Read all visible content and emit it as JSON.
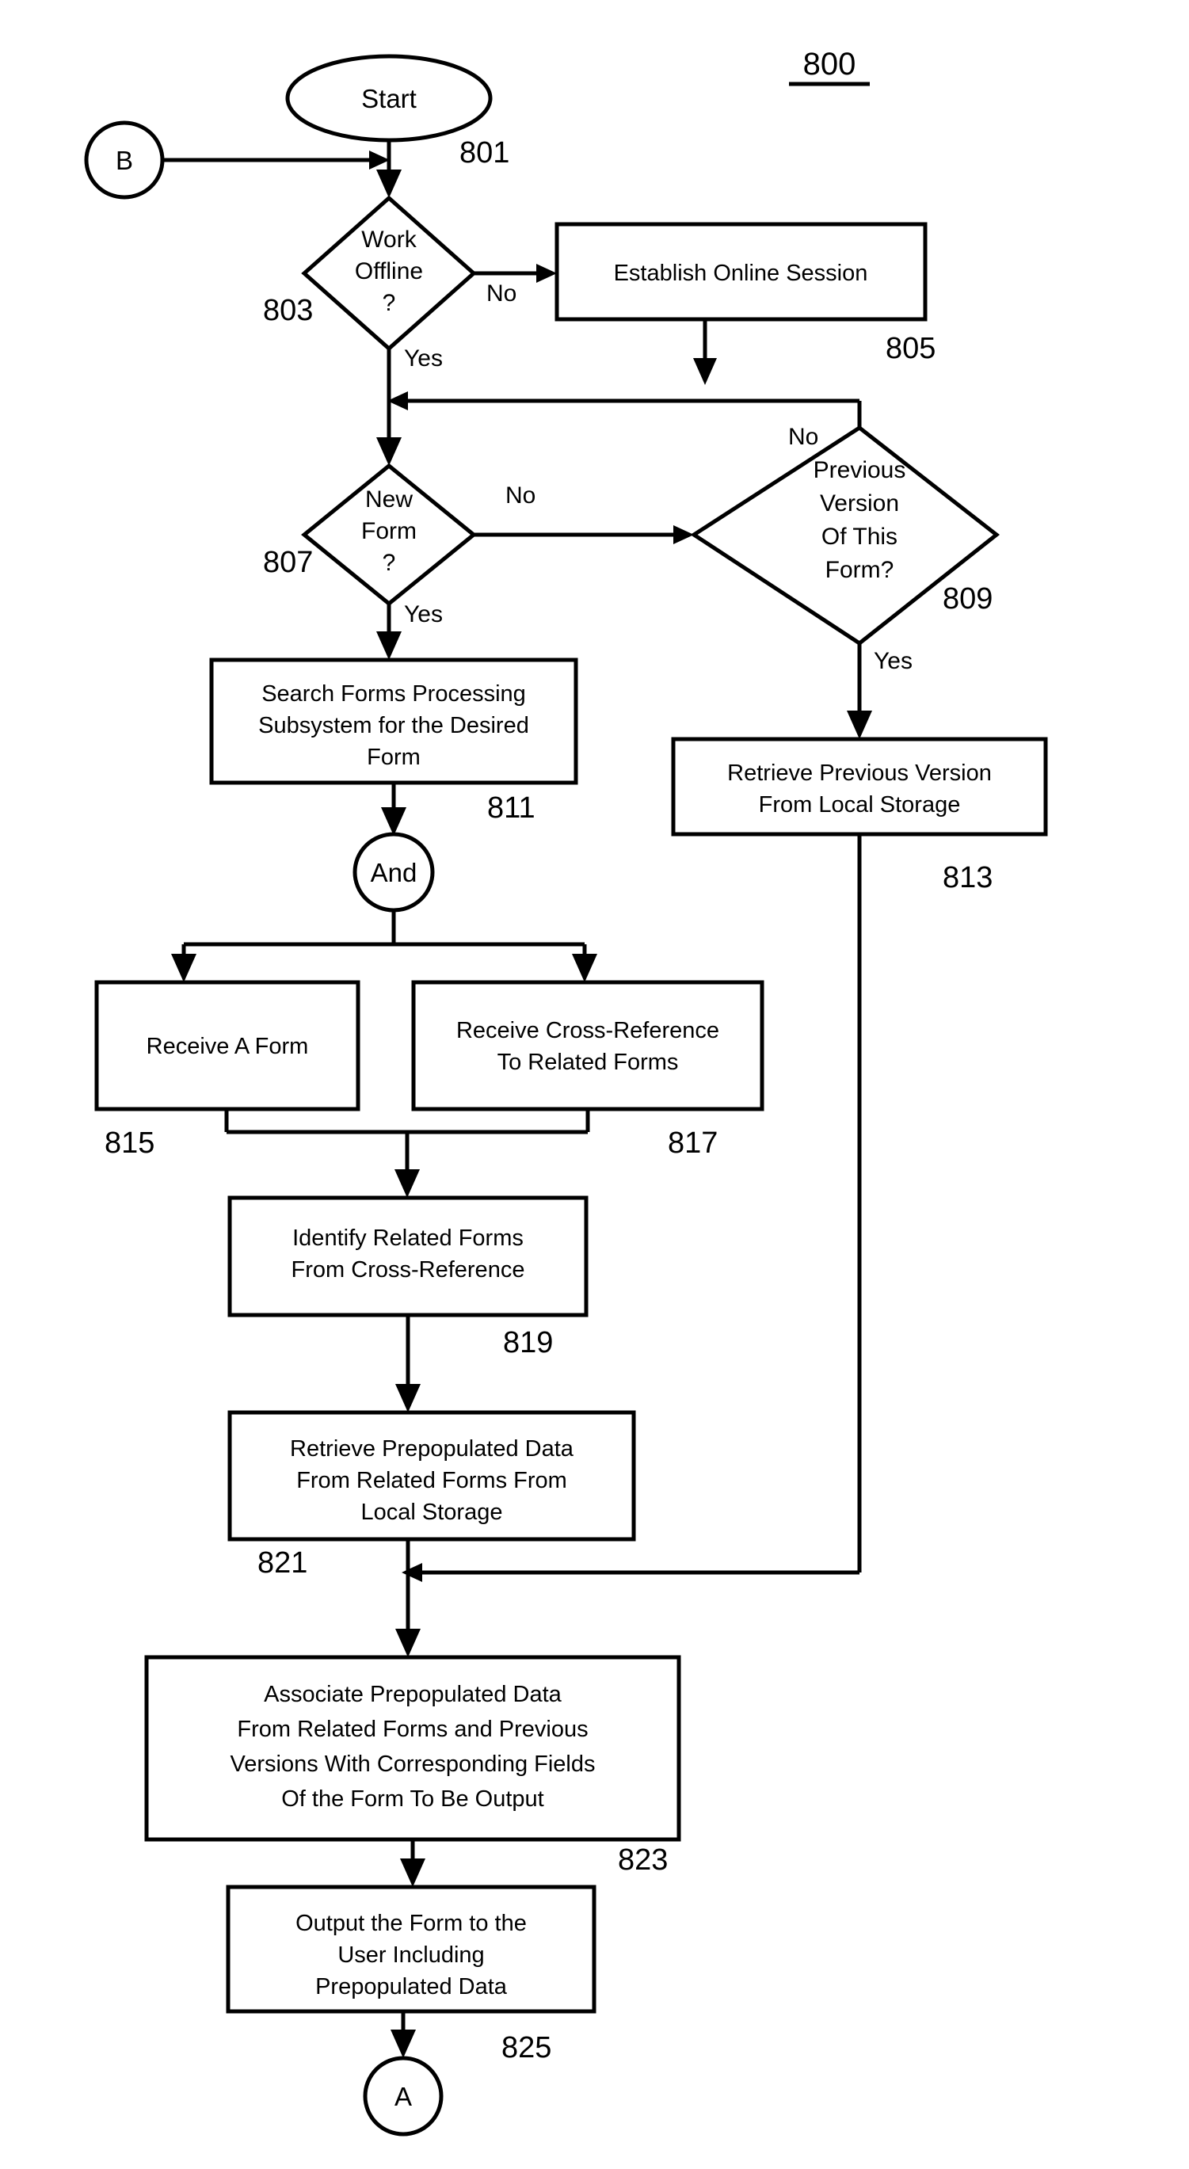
{
  "figure": {
    "number": "800",
    "underlined": true
  },
  "nodes": {
    "connector_b": {
      "label": "B",
      "shape": "circle"
    },
    "start": {
      "label": "Start",
      "shape": "ellipse",
      "ref": "801"
    },
    "work_offline": {
      "line1": "Work",
      "line2": "Offline",
      "line3": "?",
      "shape": "diamond",
      "ref": "803"
    },
    "establish_online": {
      "line1": "Establish Online Session",
      "shape": "rect",
      "ref": "805"
    },
    "new_form": {
      "line1": "New",
      "line2": "Form",
      "line3": "?",
      "shape": "diamond",
      "ref": "807"
    },
    "previous_version": {
      "line1": "Previous",
      "line2": "Version",
      "line3": "Of This",
      "line4": "Form?",
      "shape": "diamond",
      "ref": "809"
    },
    "search_forms": {
      "line1": "Search Forms Processing",
      "line2": "Subsystem for the Desired",
      "line3": "Form",
      "shape": "rect",
      "ref": "811"
    },
    "and_junction": {
      "label": "And",
      "shape": "circle"
    },
    "retrieve_previous": {
      "line1": "Retrieve Previous Version",
      "line2": "From Local Storage",
      "shape": "rect",
      "ref": "813"
    },
    "receive_form": {
      "line1": "Receive A Form",
      "shape": "rect",
      "ref": "815"
    },
    "receive_crossref": {
      "line1": "Receive Cross-Reference",
      "line2": "To Related Forms",
      "shape": "rect",
      "ref": "817"
    },
    "identify_related": {
      "line1": "Identify Related Forms",
      "line2": "From Cross-Reference",
      "shape": "rect",
      "ref": "819"
    },
    "retrieve_prepop": {
      "line1": "Retrieve Prepopulated Data",
      "line2": "From Related Forms From",
      "line3": "Local Storage",
      "shape": "rect",
      "ref": "821"
    },
    "associate_prepop": {
      "line1": "Associate Prepopulated Data",
      "line2": "From Related Forms and Previous",
      "line3": "Versions With Corresponding Fields",
      "line4": "Of the Form To Be Output",
      "shape": "rect",
      "ref": "823"
    },
    "output_form": {
      "line1": "Output the Form to the",
      "line2": "User Including",
      "line3": "Prepopulated Data",
      "shape": "rect",
      "ref": "825"
    },
    "connector_a": {
      "label": "A",
      "shape": "circle"
    }
  },
  "edge_labels": {
    "offline_no": "No",
    "offline_yes": "Yes",
    "newform_no": "No",
    "newform_yes": "Yes",
    "prev_no": "No",
    "prev_yes": "Yes"
  },
  "colors": {
    "stroke": "#000000",
    "fill": "#ffffff",
    "background": "#ffffff"
  }
}
